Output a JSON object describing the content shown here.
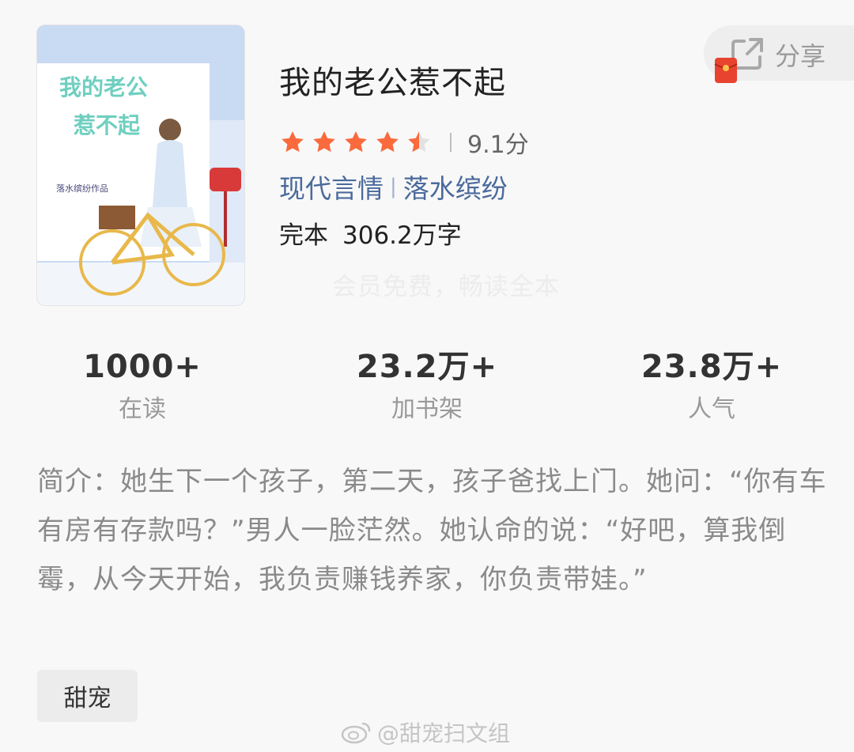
{
  "book": {
    "cover_title_line1": "我的老公",
    "cover_title_line2": "惹不起",
    "cover_author_line": "落水缤纷作品",
    "title": "我的老公惹不起",
    "rating": {
      "stars_value": 4.5,
      "stars_max": 5,
      "score_text": "9.1分"
    },
    "category": "现代言情",
    "author": "落水缤纷",
    "status": "完本",
    "word_count": "306.2万字",
    "promo": "会员免费，畅读全本"
  },
  "share": {
    "label": "分享",
    "icon": "share-icon",
    "badge_icon": "red-packet-icon"
  },
  "stats": [
    {
      "value": "1000+",
      "label": "在读"
    },
    {
      "value": "23.2万+",
      "label": "加书架"
    },
    {
      "value": "23.8万+",
      "label": "人气"
    }
  ],
  "intro": {
    "label": "简介：",
    "text": "她生下一个孩子，第二天，孩子爸找上门。她问：“你有车有房有存款吗？”男人一脸茫然。她认命的说：“好吧，算我倒霉，从今天开始，我负责赚钱养家，你负责带娃。”"
  },
  "tags": [
    "甜宠"
  ],
  "watermark": {
    "text": "@甜宠扫文组",
    "icon": "weibo-icon"
  },
  "colors": {
    "star": "#fa6a3c",
    "link": "#4b6a9c",
    "cover_title": "#6fcfc0"
  }
}
